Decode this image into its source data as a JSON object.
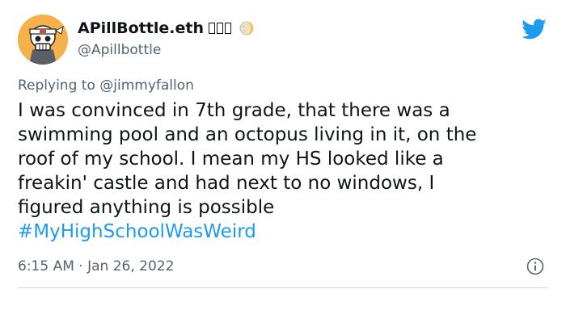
{
  "author": {
    "display_name": "APillBottle.eth",
    "handle": "@Apillbottle",
    "badge_icons": [
      "unknown-glyph-box",
      "unknown-glyph-box",
      "unknown-glyph-box",
      "moon-emoji-icon"
    ],
    "avatar_icon": "cartoon-skull-headband-avatar"
  },
  "platform_icon": "twitter-bird-icon",
  "reply": {
    "prefix": "Replying to",
    "mention": "@jimmyfallon"
  },
  "tweet": {
    "lines": [
      "I was convinced in 7th grade, that there was a",
      "swimming pool and an octopus living in it, on the",
      "roof of my school. I mean my HS looked like a",
      "freakin' castle and had next to no windows, I",
      "figured anything is possible"
    ],
    "hashtag": "#MyHighSchoolWasWeird"
  },
  "meta": {
    "time": "6:15 AM",
    "separator": "·",
    "date": "Jan 26, 2022"
  },
  "colors": {
    "link": "#1d9bf0",
    "secondary_text": "#536471",
    "primary_text": "#0f1419",
    "avatar_bg": "#f6b24a"
  }
}
